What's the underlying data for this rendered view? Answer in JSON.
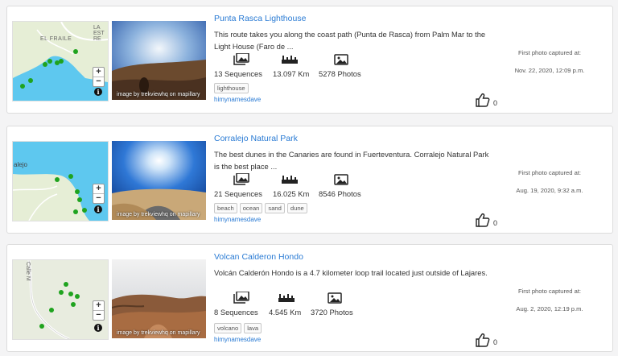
{
  "routes": [
    {
      "title": "Punta Rasca Lighthouse",
      "description": "This route takes you along the coast path (Punta de Rasca) from Palm Mar to the Light House (Faro de ...",
      "sequences": "13 Sequences",
      "distance": "13.097 Km",
      "photos": "5278 Photos",
      "tags": [
        "lighthouse"
      ],
      "author": "himynamesdave",
      "likes": "0",
      "captured_label": "First photo captured at:",
      "captured_date": "Nov. 22, 2020, 12:09 p.m.",
      "photo_credit": "image by trekviewhq on mapillary",
      "map_labels": [
        "EL FRAILE",
        "LA ESTRE"
      ]
    },
    {
      "title": "Corralejo Natural Park",
      "description": "The best dunes in the Canaries are found in Fuerteventura. Corralejo Natural Park is the best place ...",
      "sequences": "21 Sequences",
      "distance": "16.025 Km",
      "photos": "8546 Photos",
      "tags": [
        "beach",
        "ocean",
        "sand",
        "dune"
      ],
      "author": "himynamesdave",
      "likes": "0",
      "captured_label": "First photo captured at:",
      "captured_date": "Aug. 19, 2020, 9:32 a.m.",
      "photo_credit": "image by trekviewhq on mapillary",
      "map_labels": [
        "alejo"
      ]
    },
    {
      "title": "Volcan Calderon Hondo",
      "description": "Volcán Calderón Hondo is a 4.7 kilometer loop trail located just outside of Lajares.",
      "sequences": "8 Sequences",
      "distance": "4.545 Km",
      "photos": "3720 Photos",
      "tags": [
        "volcano",
        "lava"
      ],
      "author": "himynamesdave",
      "likes": "0",
      "captured_label": "First photo captured at:",
      "captured_date": "Aug. 2, 2020, 12:19 p.m.",
      "photo_credit": "image by trekviewhq on mapillary",
      "map_labels": [
        "Calle M"
      ]
    }
  ],
  "map_controls": {
    "zoom_in": "+",
    "zoom_out": "−",
    "info": "i"
  },
  "colors": {
    "link": "#2a7bd4",
    "sea": "#5ec8ef",
    "land": "#e4ecd8",
    "marker": "#1fa31f"
  },
  "icons": [
    "map-zoom-in-icon",
    "map-zoom-out-icon",
    "map-info-icon",
    "sequences-icon",
    "ruler-icon",
    "photos-icon",
    "thumbs-up-icon"
  ]
}
